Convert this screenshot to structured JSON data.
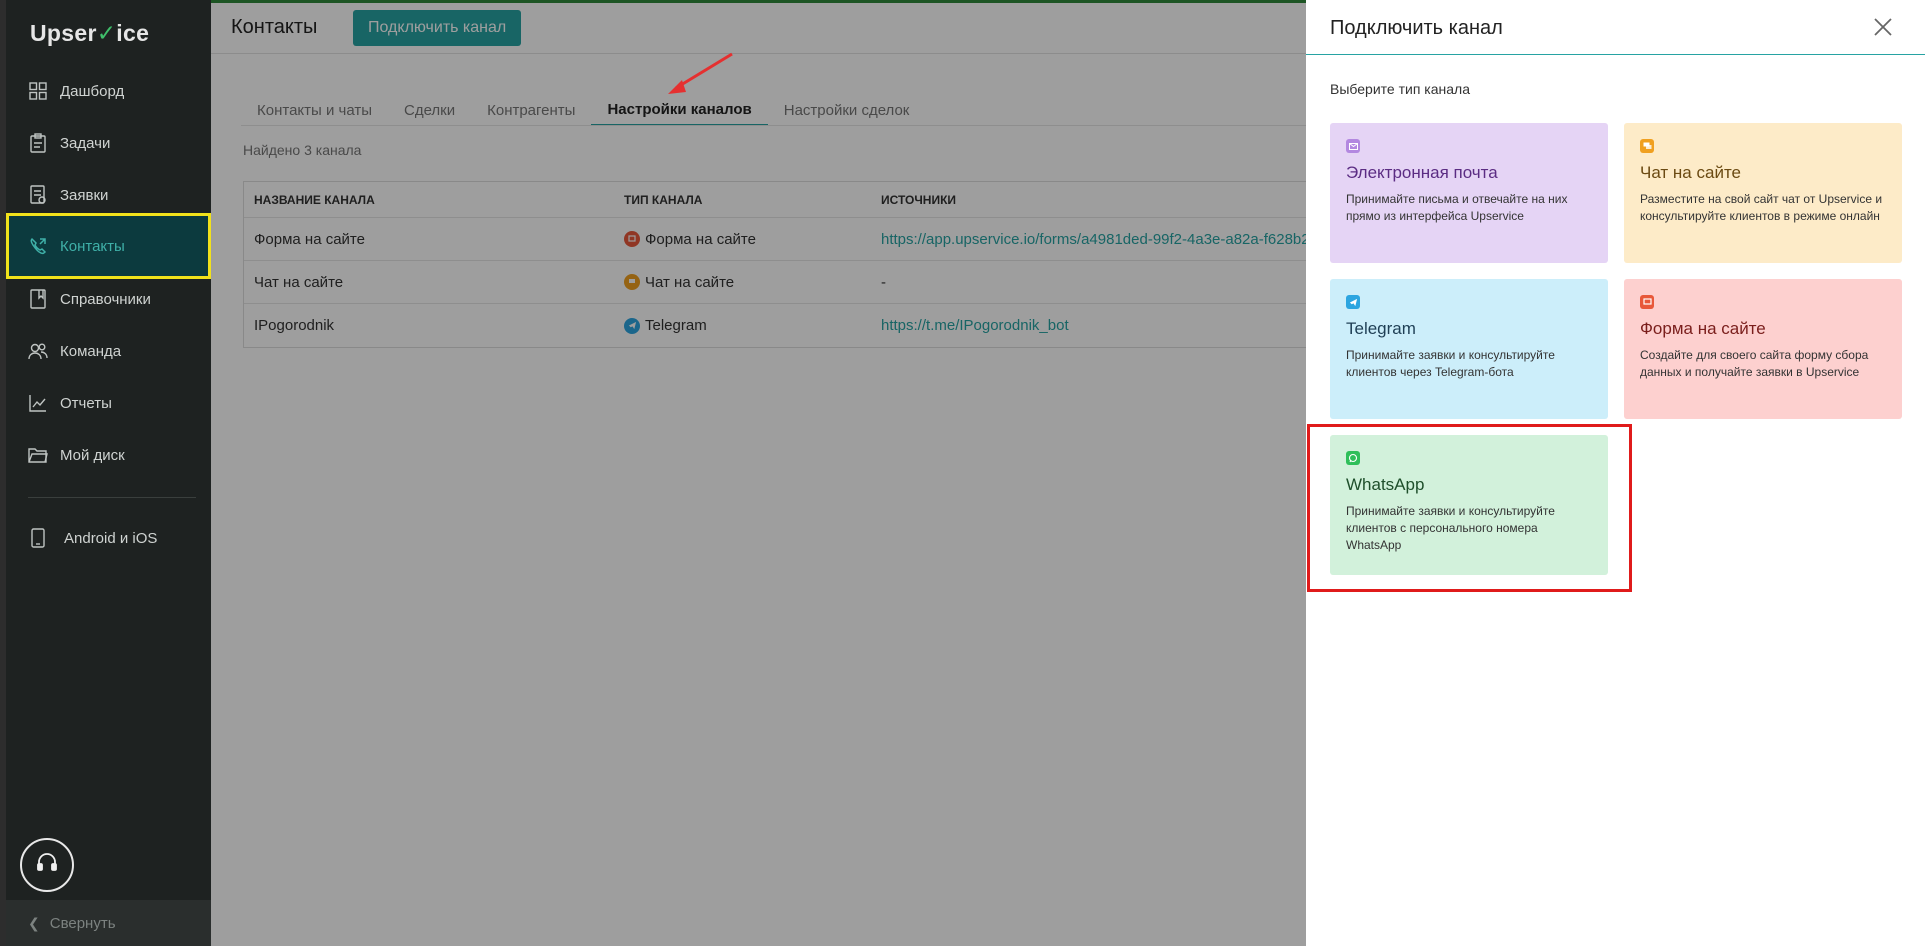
{
  "app": {
    "logo_text_1": "Upser",
    "logo_text_2": "ice",
    "logo_check": "✓"
  },
  "sidebar": {
    "items": [
      {
        "label": "Дашборд",
        "icon": "dashboard-icon"
      },
      {
        "label": "Задачи",
        "icon": "tasks-icon"
      },
      {
        "label": "Заявки",
        "icon": "requests-icon"
      },
      {
        "label": "Контакты",
        "icon": "contacts-icon",
        "active": true
      },
      {
        "label": "Справочники",
        "icon": "book-icon"
      },
      {
        "label": "Команда",
        "icon": "team-icon"
      },
      {
        "label": "Отчеты",
        "icon": "chart-icon"
      },
      {
        "label": "Мой диск",
        "icon": "folder-icon"
      }
    ],
    "mobile": {
      "label": "Android и iOS",
      "icon": "phone-icon"
    },
    "collapse_label": "Свернуть"
  },
  "header": {
    "title": "Контакты",
    "connect_button": "Подключить канал"
  },
  "tabs": [
    {
      "label": "Контакты и чаты"
    },
    {
      "label": "Сделки"
    },
    {
      "label": "Контрагенты"
    },
    {
      "label": "Настройки каналов",
      "active": true
    },
    {
      "label": "Настройки сделок"
    }
  ],
  "found_text": "Найдено 3 канала",
  "table": {
    "headers": [
      "НАЗВАНИЕ КАНАЛА",
      "ТИП КАНАЛА",
      "ИСТОЧНИКИ"
    ],
    "rows": [
      {
        "name": "Форма на сайте",
        "type": "Форма на сайте",
        "type_color": "#e8583a",
        "source": "https://app.upservice.io/forms/a4981ded-99f2-4a3e-a82a-f628b2",
        "source_is_link": true
      },
      {
        "name": "Чат на сайте",
        "type": "Чат на сайте",
        "type_color": "#f0a020",
        "source": "-",
        "source_is_link": false
      },
      {
        "name": "IPogorodnik",
        "type": "Telegram",
        "type_color": "#2ca5e0",
        "source": "https://t.me/IPogorodnik_bot",
        "source_is_link": true
      }
    ]
  },
  "panel": {
    "title": "Подключить канал",
    "subtitle": "Выберите тип канала",
    "cards": {
      "email": {
        "title": "Электронная почта",
        "desc": "Принимайте письма и отвечайте на них прямо из интерфейса Upservice",
        "color": "#b388e0"
      },
      "chat": {
        "title": "Чат на сайте",
        "desc": "Разместите на свой сайт чат от Upservice и консультируйте клиентов в режиме онлайн",
        "color": "#f0a020"
      },
      "telegram": {
        "title": "Telegram",
        "desc": "Принимайте заявки и консультируйте клиентов через Telegram-бота",
        "color": "#2ca5e0"
      },
      "form": {
        "title": "Форма на сайте",
        "desc": "Создайте для своего сайта форму сбора данных и получайте заявки в Upservice",
        "color": "#e8583a"
      },
      "whatsapp": {
        "title": "WhatsApp",
        "desc": "Принимайте заявки и консультируйте клиентов с персонального номера WhatsApp",
        "color": "#2fbf5a"
      }
    }
  }
}
